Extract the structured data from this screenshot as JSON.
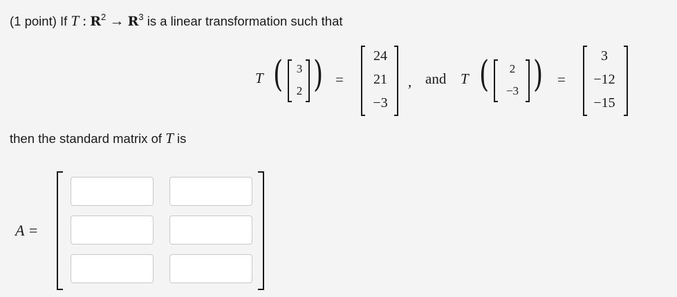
{
  "problem": {
    "points": "(1 point)",
    "if": "If",
    "T": "T",
    "colon": ":",
    "domain": "R",
    "domain_power": "2",
    "arrow": "→",
    "codomain": "R",
    "codomain_power": "3",
    "rest": "is a linear transformation such that"
  },
  "equation": {
    "T1": "T",
    "input1": [
      "3",
      "2"
    ],
    "equals1": "=",
    "output1": [
      "24",
      "21",
      "−3"
    ],
    "comma": ",",
    "and": "and",
    "T2": "T",
    "input2": [
      "2",
      "−3"
    ],
    "equals2": "=",
    "output2": [
      "3",
      "−12",
      "−15"
    ]
  },
  "then_text": {
    "before": "then the standard matrix of",
    "T": "T",
    "after": "is"
  },
  "answer": {
    "label": "A =",
    "cells": [
      "",
      "",
      "",
      "",
      "",
      ""
    ]
  }
}
